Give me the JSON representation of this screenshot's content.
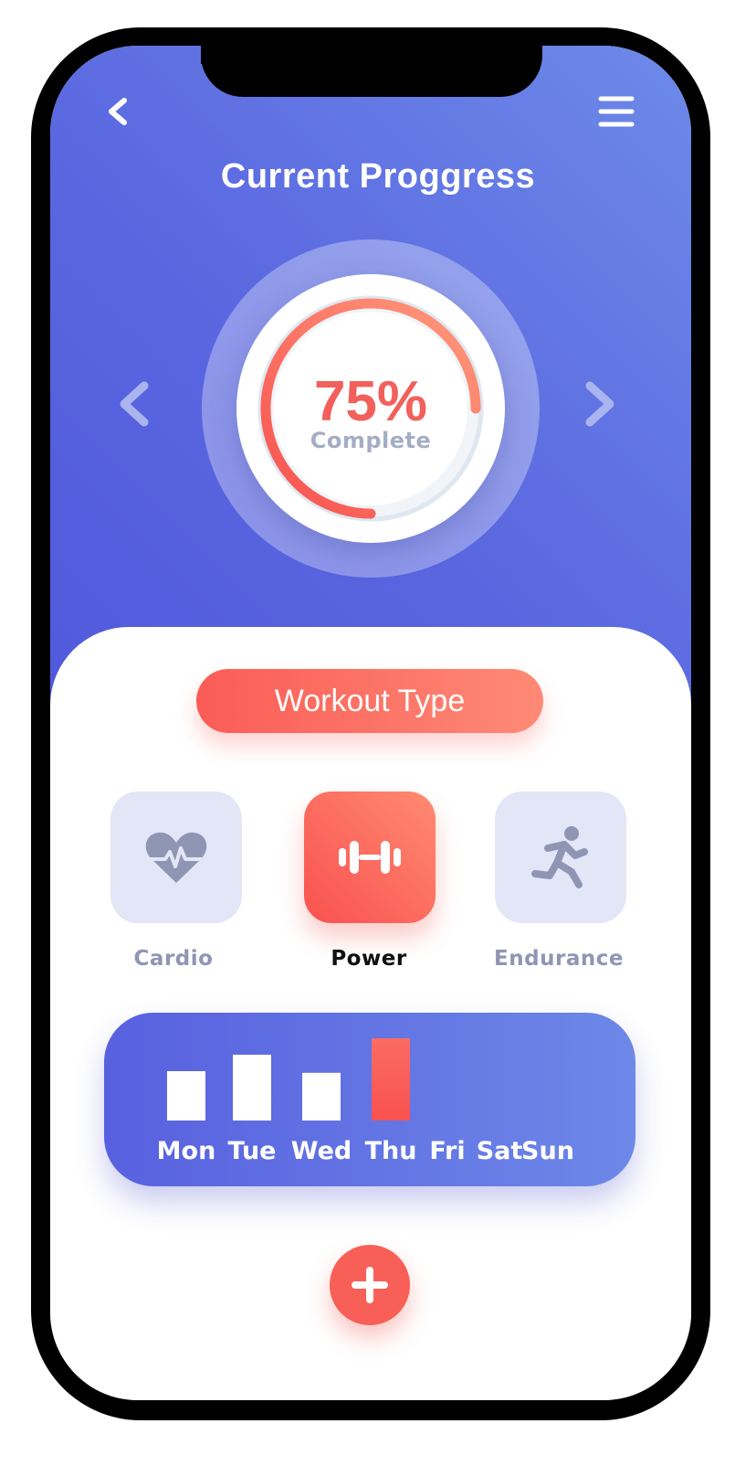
{
  "header": {
    "title": "Current Proggress",
    "back_icon": "chevron-left-icon",
    "menu_icon": "hamburger-menu-icon"
  },
  "progress": {
    "value_text": "75%",
    "caption": "Complete",
    "fraction": 0.75,
    "prev_icon": "chevron-left-icon",
    "next_icon": "chevron-right-icon"
  },
  "workout": {
    "heading": "Workout Type",
    "types": [
      {
        "label": "Cardio",
        "icon": "heart-rate-icon",
        "selected": false
      },
      {
        "label": "Power",
        "icon": "dumbbell-icon",
        "selected": true
      },
      {
        "label": "Endurance",
        "icon": "running-icon",
        "selected": false
      }
    ]
  },
  "chart_data": {
    "type": "bar",
    "categories": [
      "Mon",
      "Tue",
      "Wed",
      "Thu",
      "Fri",
      "Sat",
      "Sun"
    ],
    "values": [
      0.6,
      0.8,
      0.58,
      1.0,
      null,
      null,
      null
    ],
    "highlight": "Thu",
    "ylim": [
      0,
      1
    ]
  },
  "actions": {
    "add_icon": "plus-icon"
  },
  "colors": {
    "primary": "#5a67e0",
    "accent": "#f85f57",
    "tile_bg": "#e3e6f6",
    "muted_text": "#8f96b4"
  }
}
